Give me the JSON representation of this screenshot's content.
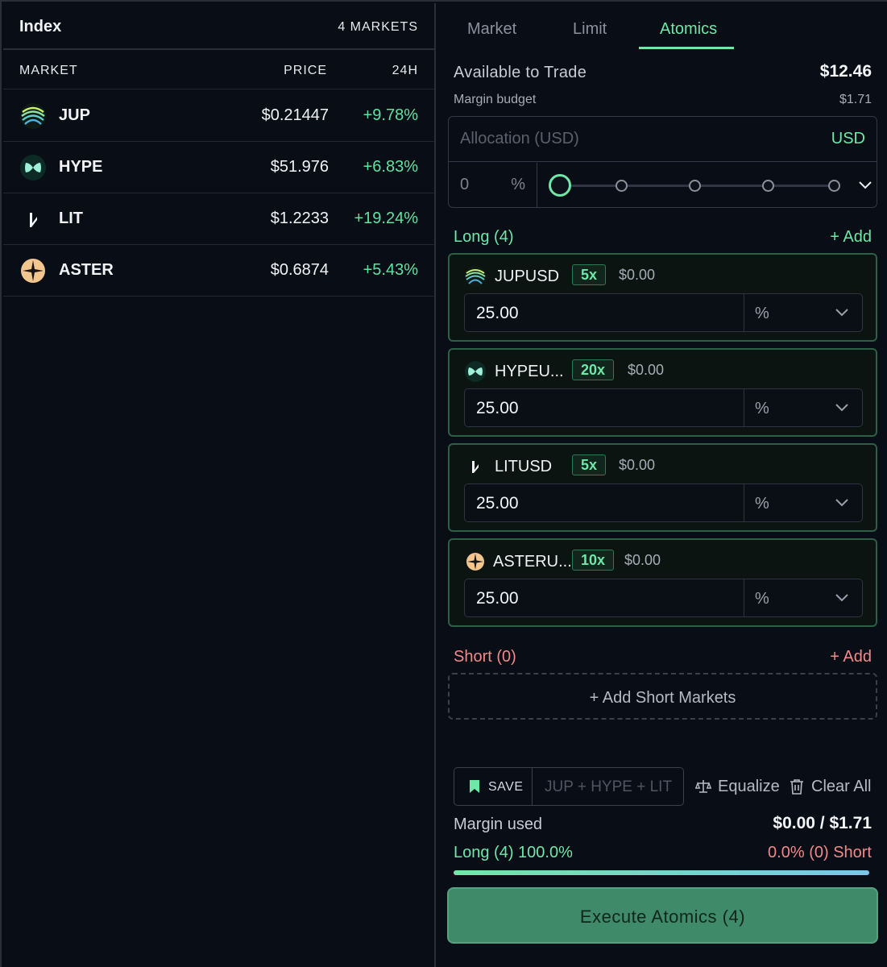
{
  "index_panel": {
    "title": "Index",
    "count": "4 MARKETS",
    "columns": {
      "market": "MARKET",
      "price": "PRICE",
      "change": "24H"
    },
    "rows": [
      {
        "name": "JUP",
        "price": "$0.21447",
        "change": "+9.78%",
        "icon": "jup-icon"
      },
      {
        "name": "HYPE",
        "price": "$51.976",
        "change": "+6.83%",
        "icon": "hype-icon"
      },
      {
        "name": "LIT",
        "price": "$1.2233",
        "change": "+19.24%",
        "icon": "lit-icon"
      },
      {
        "name": "ASTER",
        "price": "$0.6874",
        "change": "+5.43%",
        "icon": "aster-icon"
      }
    ]
  },
  "tabs": [
    {
      "label": "Market",
      "active": false
    },
    {
      "label": "Limit",
      "active": false
    },
    {
      "label": "Atomics",
      "active": true
    }
  ],
  "trade": {
    "available_label": "Available to Trade",
    "available_value": "$12.46",
    "margin_budget_label": "Margin budget",
    "margin_budget_value": "$1.71",
    "allocation_placeholder": "Allocation (USD)",
    "allocation_unit": "USD",
    "percent_value": "0",
    "percent_sign": "%",
    "slider_level": 0
  },
  "long": {
    "label": "Long (4)",
    "add_label": "+ Add",
    "cards": [
      {
        "name": "JUPUSD",
        "leverage": "5x",
        "usd": "$0.00",
        "value": "25.00",
        "unit": "%",
        "icon": "jup-icon"
      },
      {
        "name": "HYPEU...",
        "leverage": "20x",
        "usd": "$0.00",
        "value": "25.00",
        "unit": "%",
        "icon": "hype-icon"
      },
      {
        "name": "LITUSD",
        "leverage": "5x",
        "usd": "$0.00",
        "value": "25.00",
        "unit": "%",
        "icon": "lit-icon"
      },
      {
        "name": "ASTERU...",
        "leverage": "10x",
        "usd": "$0.00",
        "value": "25.00",
        "unit": "%",
        "icon": "aster-icon"
      }
    ]
  },
  "short": {
    "label": "Short (0)",
    "add_label": "+ Add",
    "empty_label": "+ Add Short Markets"
  },
  "footer": {
    "save_label": "SAVE",
    "name_placeholder": "JUP + HYPE + LIT",
    "equalize_label": "Equalize",
    "clear_label": "Clear All",
    "margin_used_label": "Margin used",
    "margin_used_value": "$0.00 / $1.71",
    "long_split": "Long (4) 100.0%",
    "short_split": "0.0% (0) Short",
    "long_fraction": 1.0,
    "execute_label": "Execute Atomics (4)"
  },
  "colors": {
    "accent": "#6ee8a8",
    "short": "#f08a8a",
    "background": "#090d16",
    "execute": "#3f8a68"
  }
}
